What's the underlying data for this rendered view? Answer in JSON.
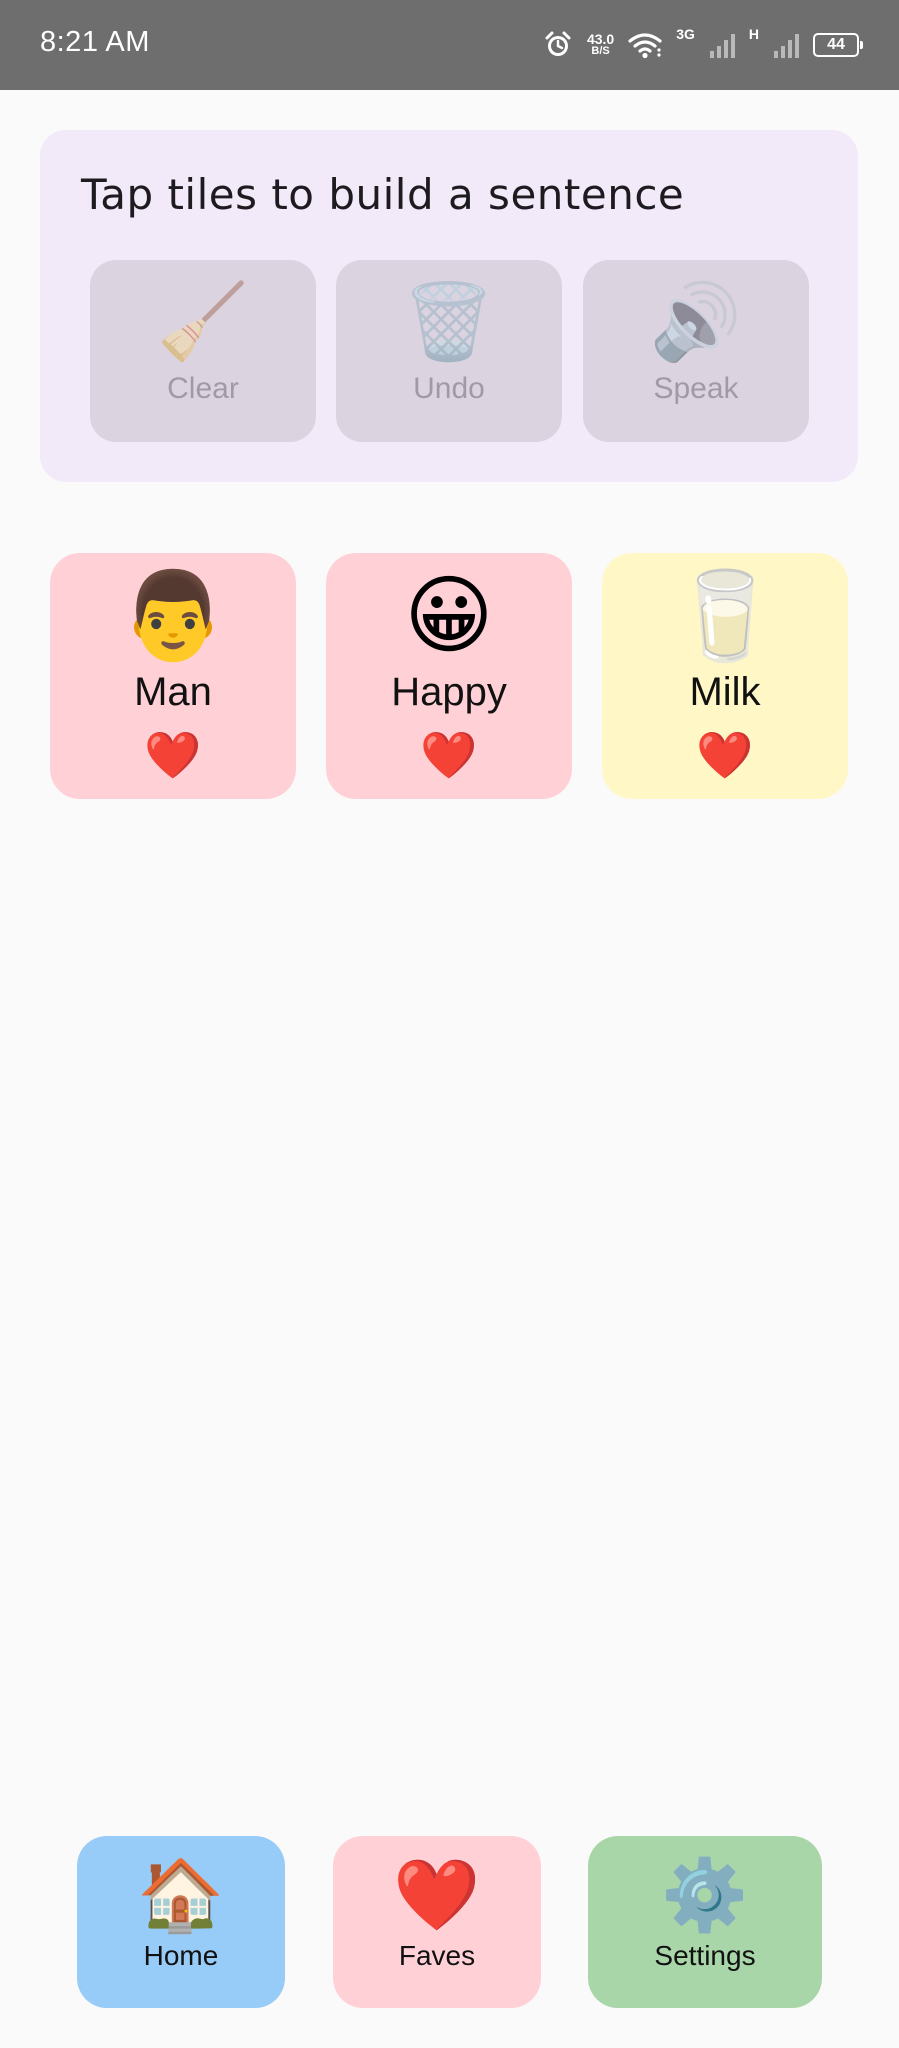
{
  "status_bar": {
    "time": "8:21 AM",
    "speed_value": "43.0",
    "speed_unit": "B/S",
    "network_3g": "3G",
    "network_h": "H",
    "battery": "44",
    "icons": [
      "alarm-icon",
      "wifi-icon",
      "signal-icon",
      "signal-icon",
      "battery-icon"
    ]
  },
  "sentence_panel": {
    "prompt": "Tap tiles to build a sentence",
    "actions": [
      {
        "label": "Clear",
        "emoji": "🧹",
        "icon": "broom-icon"
      },
      {
        "label": "Undo",
        "emoji": "🗑️",
        "icon": "trash-can-icon"
      },
      {
        "label": "Speak",
        "emoji": "🔊",
        "icon": "speaker-icon"
      }
    ]
  },
  "tiles": [
    {
      "label": "Man",
      "emoji": "👨",
      "favorite_emoji": "❤️",
      "color": "#ffd1d7"
    },
    {
      "label": "Happy",
      "emoji": "😀",
      "favorite_emoji": "❤️",
      "color": "#ffd1d7"
    },
    {
      "label": "Milk",
      "emoji": "🥛",
      "favorite_emoji": "❤️",
      "color": "#fff7c6"
    }
  ],
  "bottom_nav": [
    {
      "label": "Home",
      "emoji": "🏠",
      "color": "#97cbf8"
    },
    {
      "label": "Faves",
      "emoji": "❤️",
      "color": "#ffd1d7"
    },
    {
      "label": "Settings",
      "emoji": "⚙️",
      "color": "#a9d6a9"
    }
  ]
}
